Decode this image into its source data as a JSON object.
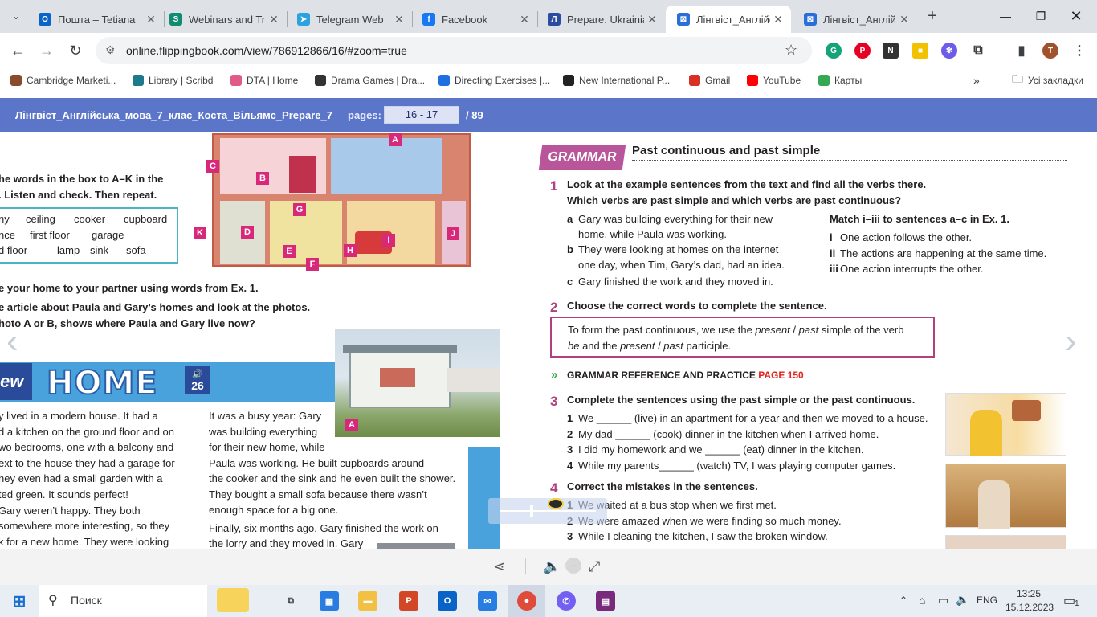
{
  "browser": {
    "tabs": [
      {
        "title": "Пошта – Tetiana",
        "icon": "outlook-icon",
        "color": "#0a64c8",
        "glyph": "O"
      },
      {
        "title": "Webinars and Tr",
        "icon": "sharepoint-icon",
        "color": "#138a72",
        "glyph": "S"
      },
      {
        "title": "Telegram Web",
        "icon": "telegram-icon",
        "color": "#2aa3df",
        "glyph": "➤"
      },
      {
        "title": "Facebook",
        "icon": "facebook-icon",
        "color": "#1877f2",
        "glyph": "f"
      },
      {
        "title": "Prepare. Ukrainia",
        "icon": "prepare-icon",
        "color": "#2b4da0",
        "glyph": "Л"
      },
      {
        "title": "Лінгвіст_Англійсь",
        "icon": "flippingbook-icon",
        "color": "#2a6fd6",
        "glyph": "⊠"
      },
      {
        "title": "Лінгвіст_Англійсь",
        "icon": "flippingbook-icon",
        "color": "#2a6fd6",
        "glyph": "⊠"
      }
    ],
    "url": "online.flippingbook.com/view/786912866/16/#zoom=true",
    "bookmarks": [
      {
        "label": "Cambridge Marketi...",
        "color": "#8b4a2b"
      },
      {
        "label": "Library | Scribd",
        "color": "#1b7a8c"
      },
      {
        "label": "DTA | Home",
        "color": "#e05a8a"
      },
      {
        "label": "Drama Games | Dra...",
        "color": "#333333"
      },
      {
        "label": "Directing Exercises |...",
        "color": "#1f6fe0"
      },
      {
        "label": "New International P...",
        "color": "#222222"
      },
      {
        "label": "Gmail",
        "color": "#d93025"
      },
      {
        "label": "YouTube",
        "color": "#ff0000"
      },
      {
        "label": "Карты",
        "color": "#34a853"
      }
    ],
    "all_bookmarks": "Усі закладки"
  },
  "viewer": {
    "doc_title": "Лінгвіст_Англійська_мова_7_клас_Коста_Вільямс_Prepare_7",
    "pages_label": "pages:",
    "pages_value": "16 - 17",
    "total": "/  89"
  },
  "left_page": {
    "ex1_line1": "he words in the box to A–K in the",
    "ex1_line2": ". Listen and check. Then repeat.",
    "words_row1": [
      "ny",
      "ceiling",
      "cooker",
      "cupboard"
    ],
    "words_row2": [
      "nce",
      "first floor",
      "garage"
    ],
    "words_row3": [
      "d floor",
      "lamp",
      "sink",
      "sofa"
    ],
    "house_labels": [
      "A",
      "B",
      "C",
      "D",
      "E",
      "F",
      "G",
      "H",
      "I",
      "J",
      "K"
    ],
    "ex2": "e your home to your partner using words from Ex. 1.",
    "ex3_line1": "e article about Paula and Gary’s homes and look at the photos.",
    "ex3_line2": "hoto  A or B, shows where Paula and Gary live now?",
    "new_prefix": "ew",
    "home_title": "HOME",
    "audio_track": "26",
    "photo_label": "A",
    "col1": [
      "y lived in a modern house. It had a",
      "d a kitchen on the ground floor and on",
      "wo bedrooms, one with a balcony and",
      "ext to the house they had a garage for",
      "hey even had a small garden with a",
      "ted green. It sounds perfect!",
      " Gary weren’t happy. They both",
      " somewhere more interesting, so they",
      "k for a new home. They were looking"
    ],
    "col2": [
      "It was a busy year: Gary",
      "was building everything",
      "for their new home, while",
      "Paula was working. He built cupboards around",
      "the cooker and the sink and he even built the shower.",
      "They bought a small sofa because there wasn’t",
      "enough space for a big one.",
      "Finally, six months ago, Gary finished the work on",
      "the lorry and they moved in. Gary"
    ]
  },
  "right_page": {
    "grammar_badge": "GRAMMAR",
    "heading": "Past continuous and past simple",
    "ex1_num": "1",
    "ex1_line1": "Look at the example sentences from the text and find all the verbs there.",
    "ex1_line2": "Which verbs are past simple and which verbs are past continuous?",
    "examples": [
      {
        "letter": "a",
        "line1": "Gary was building everything for their new",
        "line2": "home, while Paula was working."
      },
      {
        "letter": "b",
        "line1": "They were looking at homes on the internet",
        "line2": "one day, when Tim, Gary’s dad, had an idea."
      },
      {
        "letter": "c",
        "line1": "Gary finished the work and they moved in.",
        "line2": ""
      }
    ],
    "match_title": "Match i–iii to sentences a–c in Ex. 1.",
    "match_items": [
      {
        "num": "i",
        "text": "One action follows the other."
      },
      {
        "num": "ii",
        "text": "The actions are happening at the same time."
      },
      {
        "num": "iii",
        "text": "One action interrupts the other."
      }
    ],
    "ex2_num": "2",
    "ex2_text": "Choose the correct words to complete the sentence.",
    "rule_line1_a": "To form the past continuous, we use the ",
    "rule_line1_b": "present",
    "rule_line1_c": " / ",
    "rule_line1_d": "past",
    "rule_line1_e": " simple of the verb",
    "rule_line2_a": "be",
    "rule_line2_b": " and the ",
    "rule_line2_c": "present",
    "rule_line2_d": " / ",
    "rule_line2_e": "past",
    "rule_line2_f": " participle.",
    "ref_label": "GRAMMAR REFERENCE AND PRACTICE",
    "ref_page": "PAGE 150",
    "ex3_num": "3",
    "ex3_text": "Complete the sentences using the past simple or the past continuous.",
    "ex3_items": [
      {
        "num": "1",
        "text": "We ______ (live) in an apartment for a year and then we moved to a house."
      },
      {
        "num": "2",
        "text": "My dad ______ (cook) dinner in the kitchen when I arrived home."
      },
      {
        "num": "3",
        "text": "I did my homework and we ______ (eat) dinner in the kitchen."
      },
      {
        "num": "4",
        "text": "While my parents______ (watch) TV, I was playing computer games."
      }
    ],
    "ex4_num": "4",
    "ex4_text": "Correct the mistakes in the sentences.",
    "ex4_items": [
      {
        "num": "1",
        "text": "We waited at a bus stop when we first met."
      },
      {
        "num": "2",
        "text": "We were amazed when we were finding so much money."
      },
      {
        "num": "3",
        "text": "While I cleaning the kitchen, I saw the broken window."
      }
    ]
  },
  "taskbar": {
    "search": "Поиск",
    "lang": "ENG",
    "time": "13:25",
    "date": "15.12.2023",
    "notifications": "1"
  }
}
